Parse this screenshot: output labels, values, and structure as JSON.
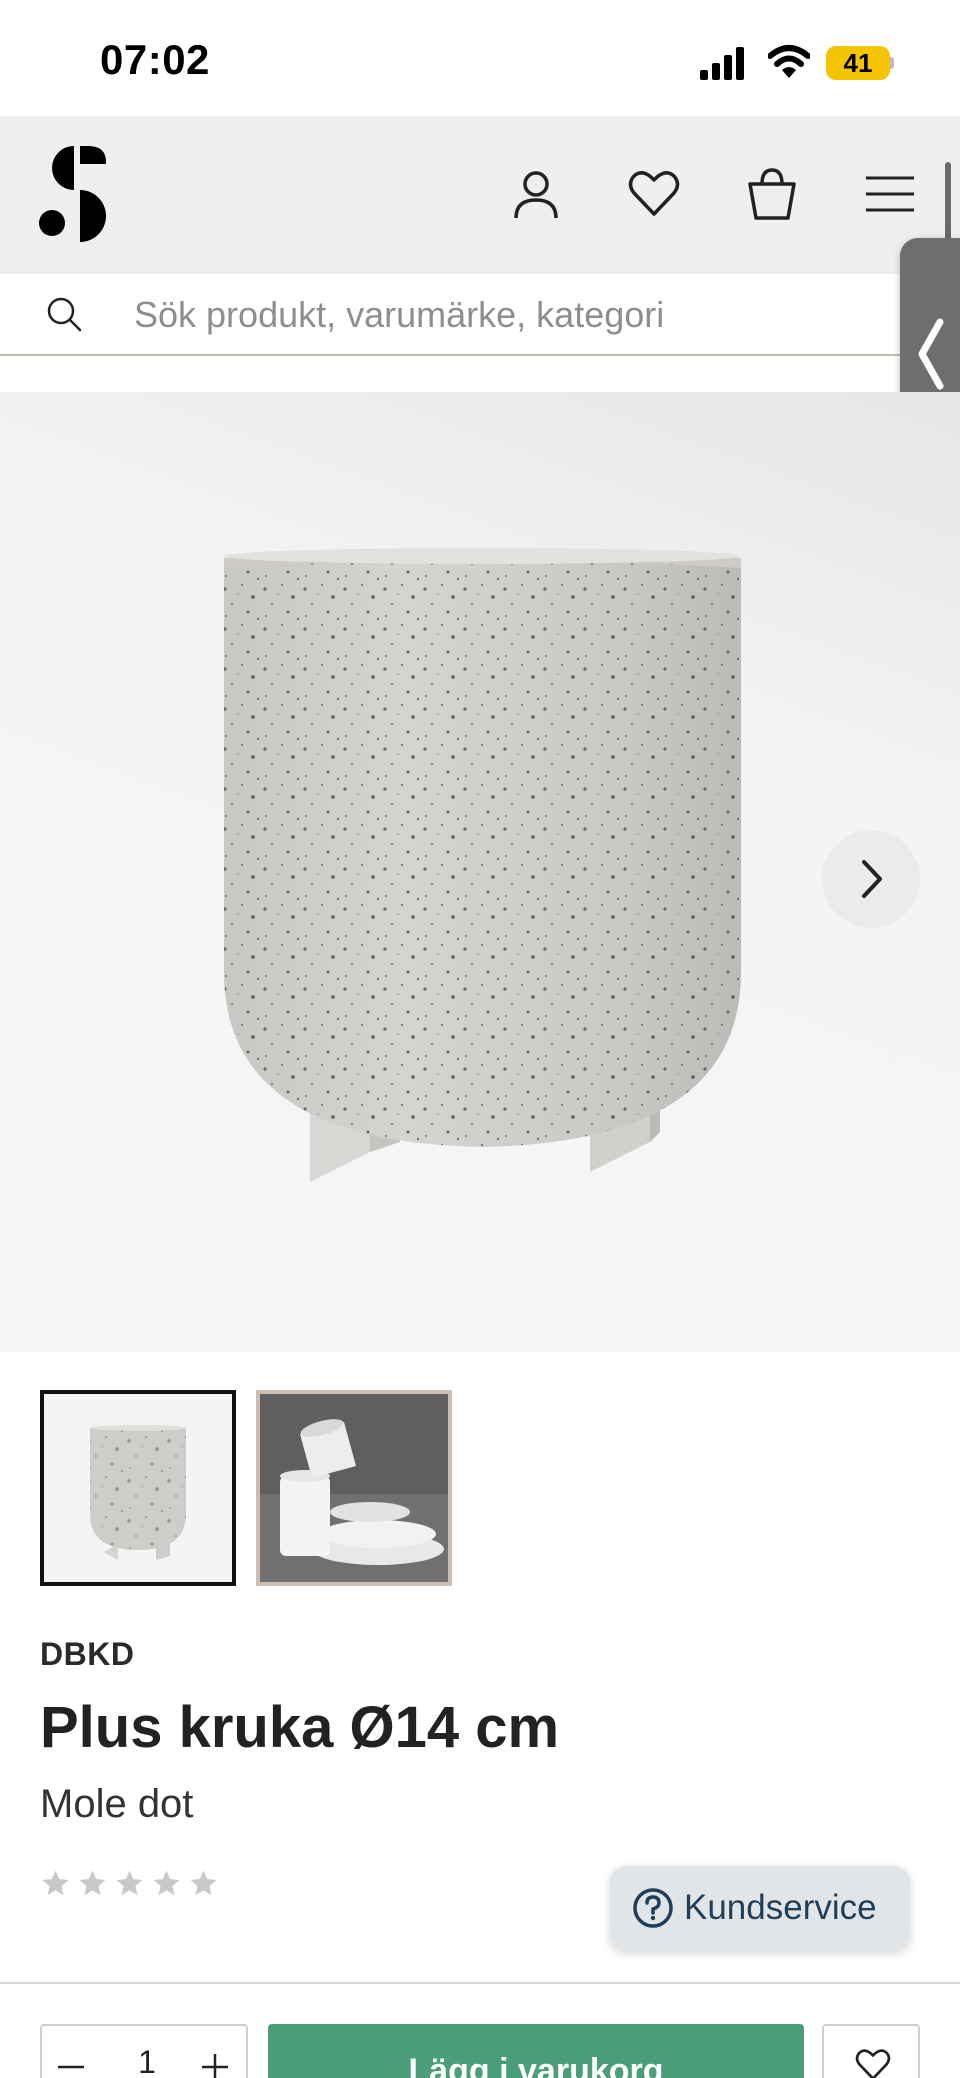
{
  "status_bar": {
    "time": "07:02",
    "battery": "41"
  },
  "header": {
    "logo": "S",
    "icons": [
      "account-icon",
      "heart-icon",
      "bag-icon",
      "menu-icon"
    ]
  },
  "search": {
    "placeholder": "Sök produkt, varumärke, kategori",
    "value": ""
  },
  "gallery": {
    "images": [
      "product-photo-pot",
      "lifestyle-photo-pots"
    ],
    "selected_index": 0
  },
  "product": {
    "brand": "DBKD",
    "title": "Plus kruka Ø14 cm",
    "variant": "Mole dot",
    "rating": {
      "filled": 0,
      "max": 5
    }
  },
  "support": {
    "label": "Kundservice"
  },
  "cart": {
    "quantity": "1",
    "add_label": "Lägg i varukorg"
  },
  "colors": {
    "accent": "#4a9f79",
    "header_bg": "#f0efed",
    "support_text": "#1f3f5a",
    "battery": "#f5c400"
  }
}
